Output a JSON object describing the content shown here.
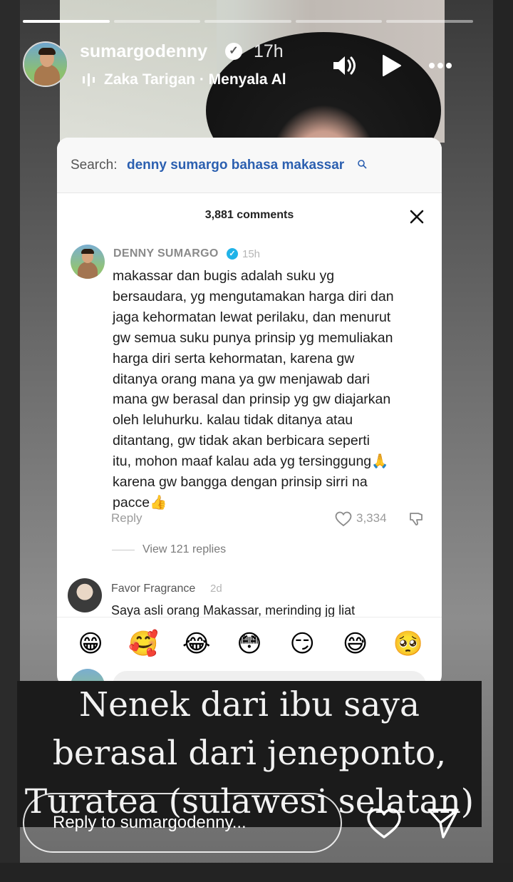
{
  "header": {
    "username": "sumargodenny",
    "time": "17h",
    "music": "Zaka Tarigan · Menyala Al",
    "icons": [
      "volume-icon",
      "play-icon",
      "more-icon"
    ],
    "progress_segments": 5,
    "progress_done": 1
  },
  "card": {
    "search_label": "Search:",
    "search_query": "denny sumargo bahasa makassar",
    "comments_count": "3,881 comments",
    "comment1": {
      "author": "DENNY SUMARGO",
      "time": "15h",
      "text": "makassar dan bugis adalah suku yg\nbersaudara, yg mengutamakan harga diri dan\njaga kehormatan lewat perilaku, dan menurut\ngw semua suku punya prinsip yg memuliakan\nharga diri serta kehormatan, karena gw\nditanya orang mana ya gw menjawab dari\nmana gw berasal dan prinsip yg gw diajarkan\noleh leluhurku. kalau tidak ditanya atau\nditantang, gw tidak akan berbicara seperti\nitu, mohon maaf kalau ada yg tersinggung🙏\nkarena gw bangga dengan prinsip sirri na\npacce👍",
      "reply_label": "Reply",
      "likes": "3,334",
      "view_replies": "View 121 replies"
    },
    "comment2": {
      "author": "Favor Fragrance",
      "time": "2d",
      "text": "Saya asli orang Makassar, merinding jg liat"
    },
    "emojis": [
      "😁",
      "🥰",
      "😂",
      "😳",
      "😏",
      "😅",
      "🥺"
    ]
  },
  "caption": {
    "line1": "Nenek dari ibu saya",
    "line2": "berasal dari jeneponto,",
    "line3": "Turatea (sulawesi selatan)"
  },
  "reply_bar": {
    "placeholder": "Reply to sumargodenny..."
  }
}
